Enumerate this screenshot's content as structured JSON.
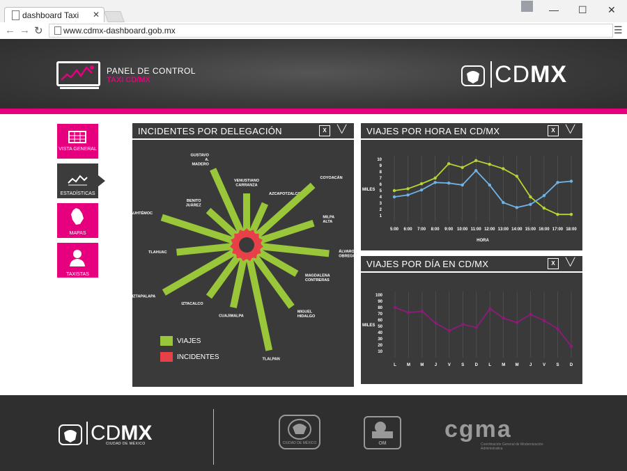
{
  "browser": {
    "tab_title": "dashboard Taxi",
    "url": "www.cdmx-dashboard.gob.mx"
  },
  "header": {
    "title_line1": "PANEL DE CONTROL",
    "title_line2": "TAXI CD/MX",
    "brand_light": "CD",
    "brand_bold": "MX"
  },
  "sidebar": {
    "items": [
      {
        "label": "VISTA GENERAL",
        "icon": "grid-table-icon",
        "active": false
      },
      {
        "label": "ESTADÍSTICAS",
        "icon": "line-chart-icon",
        "active": true
      },
      {
        "label": "MAPAS",
        "icon": "map-icon",
        "active": false
      },
      {
        "label": "TAXISTAS",
        "icon": "person-icon",
        "active": false
      }
    ]
  },
  "colors": {
    "accent": "#e6007e",
    "viajes": "#9ac63a",
    "incidentes": "#e84048",
    "panel": "#3b3a3a",
    "line_blue": "#6fb4e6",
    "line_green": "#b8d432",
    "line_magenta": "#8e1a7a"
  },
  "panels": {
    "delegacion": {
      "title": "INCIDENTES POR DELEGACIÓN"
    },
    "hora": {
      "title": "VIAJES POR HORA EN CD/MX"
    },
    "dia": {
      "title": "VIAJES POR DÍA EN CD/MX"
    }
  },
  "chart_data": [
    {
      "type": "radial-bar",
      "legend": [
        "VIAJES",
        "INCIDENTES"
      ],
      "categories": [
        "VENUSTIANO CARRANZA",
        "AZCAPOTZALCO",
        "COYOACÁN",
        "MILPA ALTA",
        "ÁLVARO OBREGÓN",
        "MAGDALENA CONTRERAS",
        "MIGUEL HIDALGO",
        "TLALPAN",
        "CUAJIMALPA",
        "IZTACALCO",
        "IZTAPALAPA",
        "TLAHUAC",
        "CUAUHTÉMOC",
        "BENITO JUÁREZ",
        "GUSTAVO A. MADERO"
      ],
      "series": [
        {
          "name": "VIAJES",
          "values": [
            3,
            2.5,
            6,
            4.5,
            5.5,
            3.5,
            5,
            7.5,
            4,
            4,
            6.5,
            4.5,
            6,
            3,
            5.5
          ]
        }
      ],
      "incidentes_values": [
        1,
        1,
        1,
        1,
        1,
        1,
        1,
        1,
        1,
        1,
        1,
        1,
        1,
        1,
        1
      ]
    },
    {
      "type": "line",
      "xlabel": "HORA",
      "ylabel": "MILES",
      "categories": [
        "5:00",
        "6:00",
        "7:00",
        "8:00",
        "9:00",
        "10:00",
        "11:00",
        "12:00",
        "13:00",
        "14:00",
        "15:00",
        "16:00",
        "17:00",
        "18:00"
      ],
      "y_ticks": [
        1,
        2,
        3,
        4,
        5,
        6,
        7,
        8,
        9,
        10
      ],
      "ylim": [
        0,
        10
      ],
      "series": [
        {
          "color": "green",
          "values": [
            5,
            5.3,
            6.1,
            7,
            9.3,
            8.7,
            9.8,
            9.2,
            8.5,
            7.3,
            4,
            2.2,
            1.2,
            1.2
          ]
        },
        {
          "color": "blue",
          "values": [
            4,
            4.3,
            5.1,
            6.3,
            6.2,
            5.9,
            8.2,
            5.9,
            3.1,
            2.3,
            2.8,
            4.2,
            6.3,
            6.5
          ]
        }
      ]
    },
    {
      "type": "line",
      "ylabel": "MILES",
      "categories": [
        "L",
        "M",
        "M",
        "J",
        "V",
        "S",
        "D",
        "L",
        "M",
        "M",
        "J",
        "V",
        "S",
        "D"
      ],
      "y_ticks": [
        10,
        20,
        30,
        40,
        50,
        60,
        70,
        80,
        90,
        100
      ],
      "ylim": [
        0,
        100
      ],
      "series": [
        {
          "color": "magenta",
          "values": [
            80,
            72,
            74,
            55,
            43,
            53,
            48,
            78,
            63,
            56,
            69,
            59,
            46,
            18
          ]
        }
      ]
    }
  ],
  "footer": {
    "brand_light": "CD",
    "brand_bold": "MX",
    "brand_sub": "CIUDAD DE MÉXICO",
    "logo1_text": "CIUDAD DE MÉXICO",
    "logo2_text": "OM",
    "logo3_text": "cgma",
    "logo3_sub": "Coordinación General de Modernización Administrativa"
  }
}
